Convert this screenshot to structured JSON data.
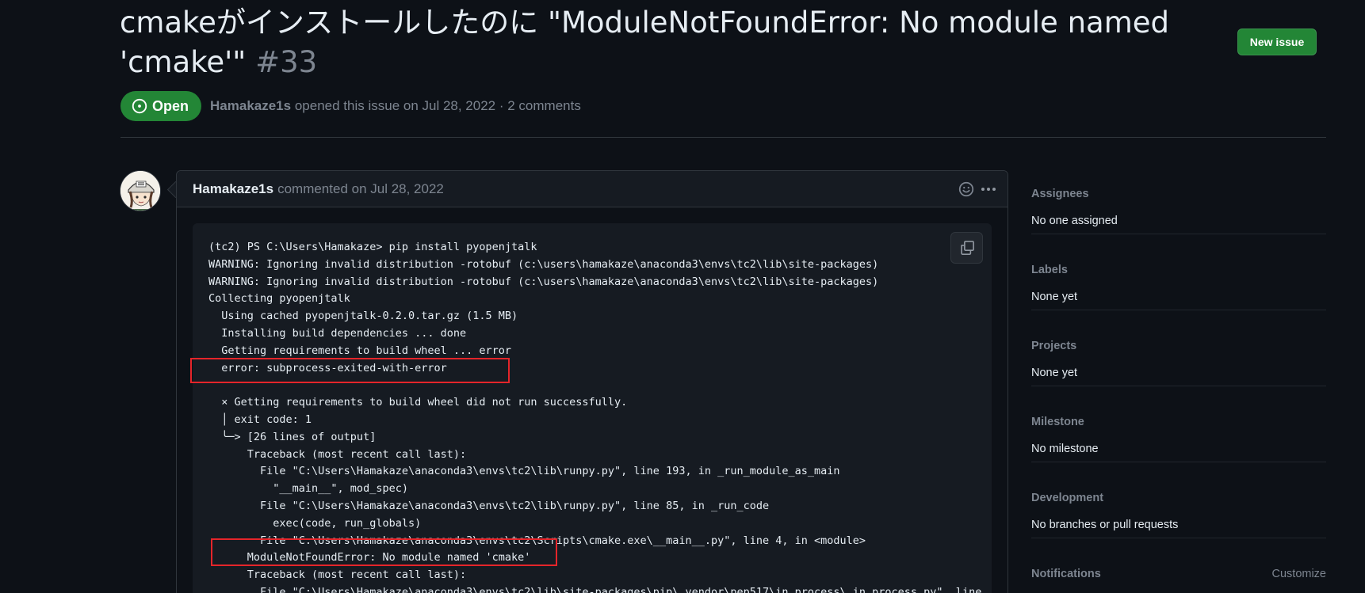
{
  "issue": {
    "title": "cmakeがインストールしたのに \"ModuleNotFoundError: No module named 'cmake'\"",
    "number": "#33",
    "state": "Open",
    "author": "Hamakaze1s",
    "opened_text": "opened this issue on Jul 28, 2022 · 2 comments",
    "new_issue_label": "New issue"
  },
  "comment": {
    "author": "Hamakaze1s",
    "date_text": "commented on Jul 28, 2022",
    "code_lines": [
      "(tc2) PS C:\\Users\\Hamakaze> pip install pyopenjtalk",
      "WARNING: Ignoring invalid distribution -rotobuf (c:\\users\\hamakaze\\anaconda3\\envs\\tc2\\lib\\site-packages)",
      "WARNING: Ignoring invalid distribution -rotobuf (c:\\users\\hamakaze\\anaconda3\\envs\\tc2\\lib\\site-packages)",
      "Collecting pyopenjtalk",
      "  Using cached pyopenjtalk-0.2.0.tar.gz (1.5 MB)",
      "  Installing build dependencies ... done",
      "  Getting requirements to build wheel ... error",
      "  error: subprocess-exited-with-error",
      "",
      "  × Getting requirements to build wheel did not run successfully.",
      "  │ exit code: 1",
      "  ╰─> [26 lines of output]",
      "      Traceback (most recent call last):",
      "        File \"C:\\Users\\Hamakaze\\anaconda3\\envs\\tc2\\lib\\runpy.py\", line 193, in _run_module_as_main",
      "          \"__main__\", mod_spec)",
      "        File \"C:\\Users\\Hamakaze\\anaconda3\\envs\\tc2\\lib\\runpy.py\", line 85, in _run_code",
      "          exec(code, run_globals)",
      "        File \"C:\\Users\\Hamakaze\\anaconda3\\envs\\tc2\\Scripts\\cmake.exe\\__main__.py\", line 4, in <module>",
      "      ModuleNotFoundError: No module named 'cmake'",
      "      Traceback (most recent call last):",
      "        File \"C:\\Users\\Hamakaze\\anaconda3\\envs\\tc2\\lib\\site-packages\\pip\\_vendor\\pep517\\in_process\\_in_process.py\", line"
    ]
  },
  "sidebar": {
    "sections": [
      {
        "heading": "Assignees",
        "value": "No one assigned"
      },
      {
        "heading": "Labels",
        "value": "None yet"
      },
      {
        "heading": "Projects",
        "value": "None yet"
      },
      {
        "heading": "Milestone",
        "value": "No milestone"
      },
      {
        "heading": "Development",
        "value": "No branches or pull requests"
      }
    ],
    "notifications_heading": "Notifications",
    "customize_label": "Customize"
  },
  "colors": {
    "background": "#0d1117",
    "open_green": "#238636",
    "annotation_red": "#e5252a"
  },
  "icons": [
    "issue-opened-icon",
    "smiley-icon",
    "kebab-horizontal-icon",
    "copy-icon"
  ]
}
